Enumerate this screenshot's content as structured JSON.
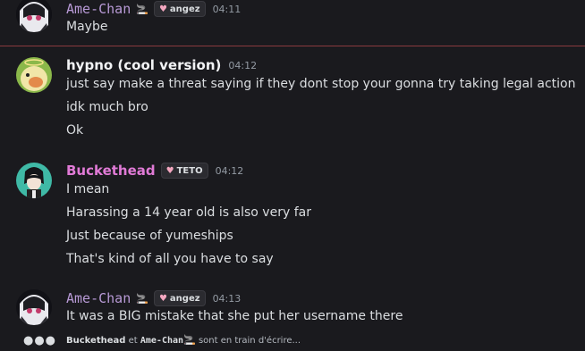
{
  "colors": {
    "background": "#1a1a1e",
    "ame_name": "#b89ad6",
    "hypno_name": "#f2f3f5",
    "buckethead_name": "#e07ad6",
    "new_divider": "#8a3a3e"
  },
  "messages": [
    {
      "author": "Ame-Chan",
      "author_suffix": "🚬",
      "tag_icon": "heart-icon",
      "tag": "angez",
      "time": "04:11",
      "lines": [
        "Maybe"
      ]
    },
    {
      "author": "hypno (cool version)",
      "time": "04:12",
      "lines": [
        "just say make a threat saying if they dont stop your gonna try taking legal action",
        "idk much bro",
        "Ok"
      ]
    },
    {
      "author": "Buckethead",
      "tag_icon": "heart-icon",
      "tag": "TETO",
      "time": "04:12",
      "lines": [
        "I mean",
        "Harassing a 14 year old is also very far",
        "Just because of yumeships",
        "That's kind of all you have to say"
      ]
    },
    {
      "author": "Ame-Chan",
      "author_suffix": "🚬",
      "tag_icon": "heart-icon",
      "tag": "angez",
      "time": "04:13",
      "lines": [
        "It was a BIG mistake that she put her username there"
      ]
    }
  ],
  "typing": {
    "dots": "●●●",
    "user1": "Buckethead",
    "conj": "et",
    "user2": "Ame-Chan",
    "user2_suffix": "🚬",
    "suffix": "sont en train d'écrire..."
  }
}
